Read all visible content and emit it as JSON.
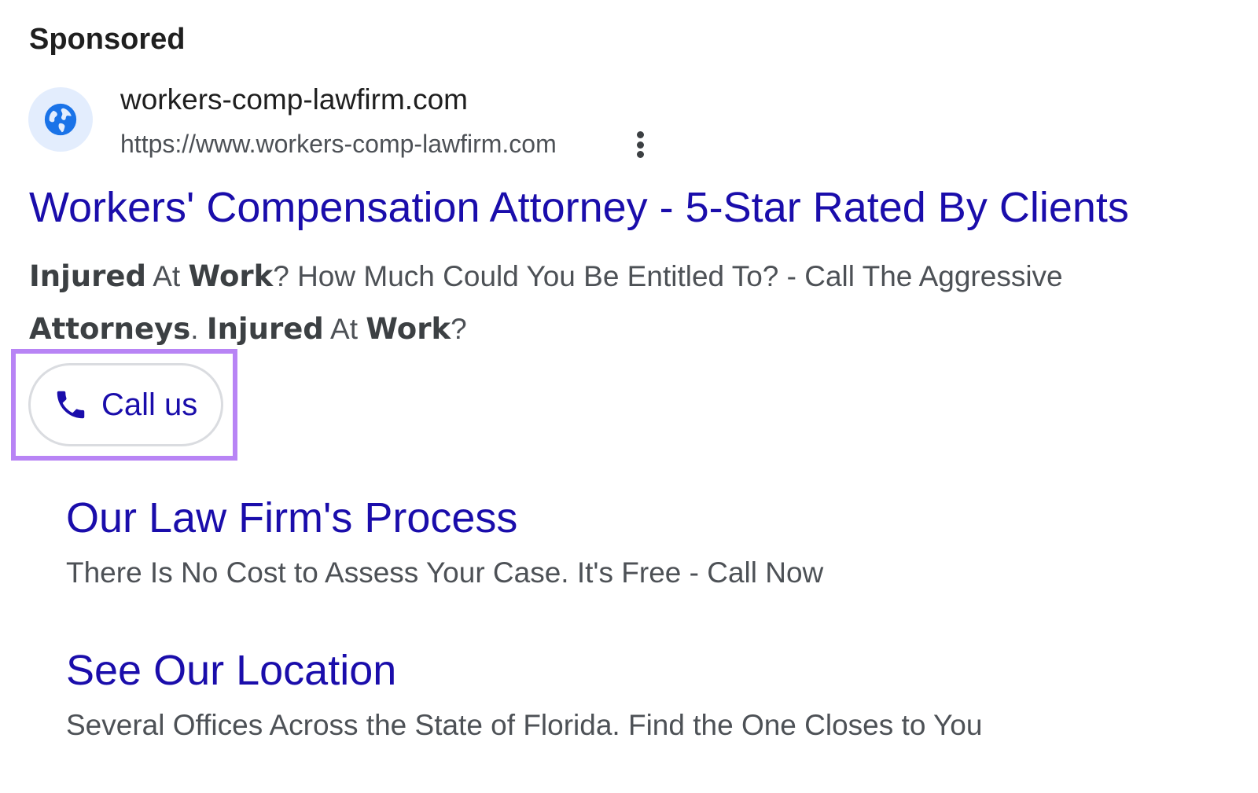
{
  "ad": {
    "sponsored_label": "Sponsored",
    "favicon_icon": "globe-icon",
    "site_name": "workers-comp-lawfirm.com",
    "display_url": "https://www.workers-comp-lawfirm.com",
    "more_options_icon": "more-vert-icon",
    "headline": "Workers' Compensation Attorney - 5-Star Rated By Clients",
    "description": [
      {
        "text": "Injured",
        "bold": true
      },
      {
        "text": " At ",
        "bold": false
      },
      {
        "text": "Work",
        "bold": true
      },
      {
        "text": "? How Much Could You Be Entitled To? - Call The Aggressive ",
        "bold": false
      },
      {
        "text": "Attorneys",
        "bold": true
      },
      {
        "text": ". ",
        "bold": false
      },
      {
        "text": "Injured",
        "bold": true
      },
      {
        "text": " At ",
        "bold": false
      },
      {
        "text": "Work",
        "bold": true
      },
      {
        "text": "?",
        "bold": false
      }
    ],
    "call_button": {
      "icon": "phone-icon",
      "label": "Call us"
    },
    "sitelinks": [
      {
        "title": "Our Law Firm's Process",
        "description": "There Is No Cost to Assess Your Case. It's Free - Call Now"
      },
      {
        "title": "See Our Location",
        "description": "Several Offices Across the State of Florida. Find the One Closes to You"
      }
    ]
  },
  "colors": {
    "link_blue": "#1a0dab",
    "text_gray": "#4d5156",
    "highlight_purple": "#b884f5",
    "favicon_bg": "#e3edfd",
    "favicon_fg": "#1a73e8"
  }
}
